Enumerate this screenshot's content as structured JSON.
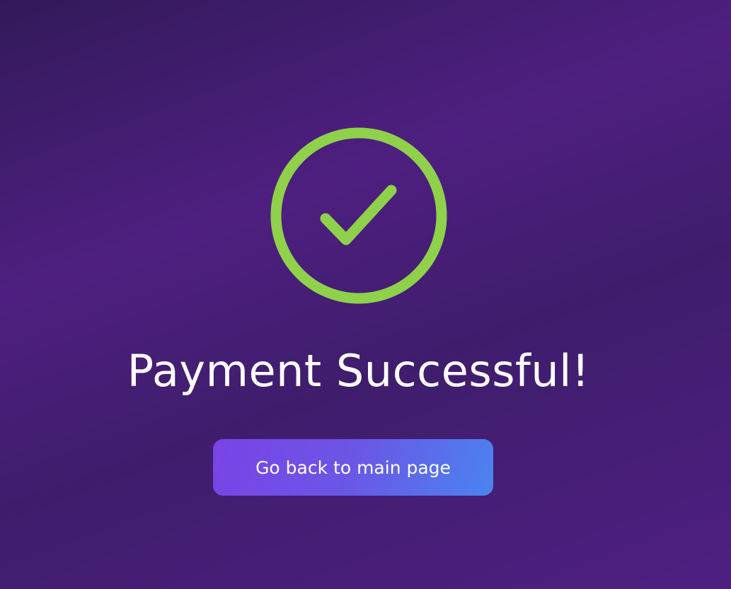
{
  "status": {
    "icon": "check-circle-icon",
    "icon_color": "#8fd14a"
  },
  "title": "Payment Successful!",
  "back_button": {
    "label": "Go back to main page"
  },
  "colors": {
    "background": "#4b1e7e",
    "button_gradient_start": "#7b42e6",
    "button_gradient_end": "#4a84f0",
    "text": "#ffffff"
  }
}
